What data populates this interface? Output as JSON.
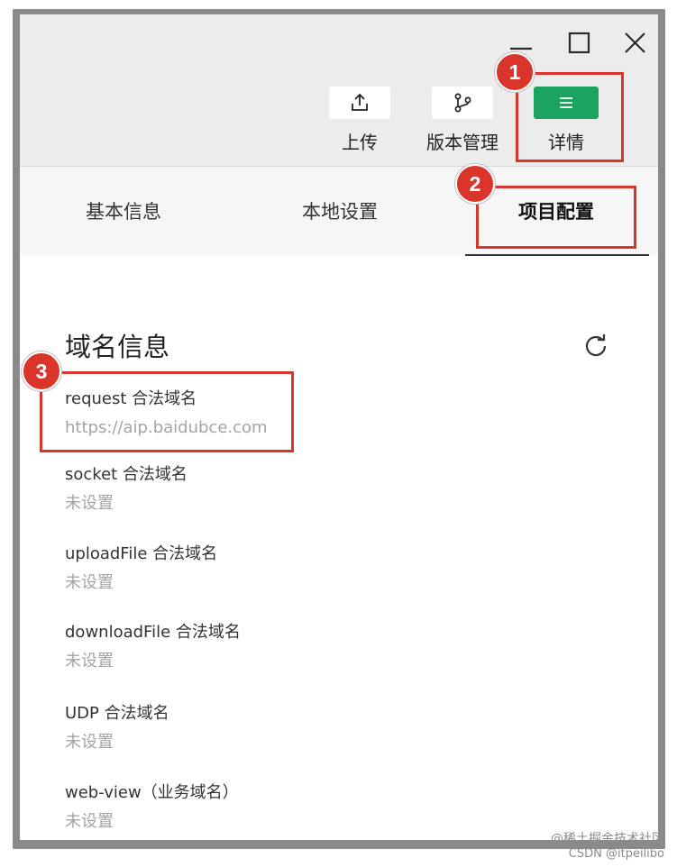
{
  "toolbar": {
    "upload_label": "上传",
    "version_label": "版本管理",
    "details_label": "详情"
  },
  "tabs": [
    {
      "label": "基本信息"
    },
    {
      "label": "本地设置"
    },
    {
      "label": "项目配置",
      "active": true
    }
  ],
  "domain_section": {
    "title": "域名信息",
    "fields": [
      {
        "label": "request 合法域名",
        "value": "https://aip.baidubce.com"
      },
      {
        "label": "socket 合法域名",
        "value": "未设置"
      },
      {
        "label": "uploadFile 合法域名",
        "value": "未设置"
      },
      {
        "label": "downloadFile 合法域名",
        "value": "未设置"
      },
      {
        "label": "UDP 合法域名",
        "value": "未设置"
      },
      {
        "label": "web-view（业务域名）",
        "value": "未设置"
      }
    ]
  },
  "annotations": {
    "badge_1": "1",
    "badge_2": "2",
    "badge_3": "3",
    "color": "#d9352b"
  },
  "watermark": {
    "line1": "@稀土掘金技术社区",
    "line2": "CSDN @itpeilibo"
  },
  "colors": {
    "accent": "#1aa260",
    "annotation_red": "#d9352b"
  }
}
